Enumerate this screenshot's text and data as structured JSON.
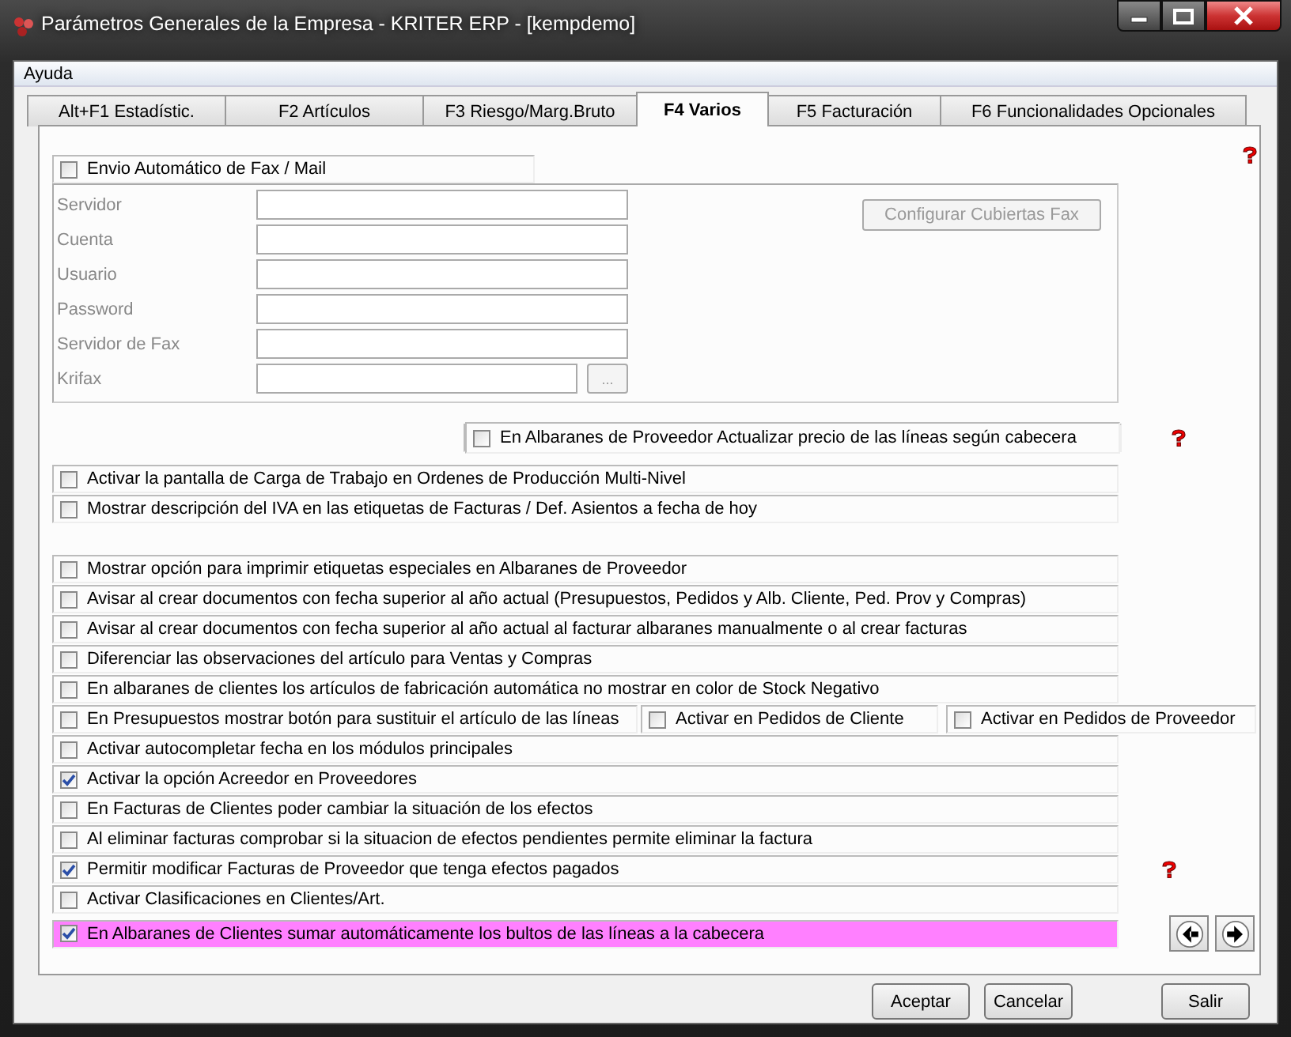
{
  "window": {
    "title": "Parámetros Generales de la Empresa - KRITER ERP - [kempdemo]"
  },
  "menu": [
    "Ayuda"
  ],
  "tabs": [
    {
      "label": "Alt+F1 Estadístic.",
      "selected": false
    },
    {
      "label": "F2 Artículos",
      "selected": false
    },
    {
      "label": "F3 Riesgo/Marg.Bruto",
      "selected": false
    },
    {
      "label": "F4 Varios",
      "selected": true
    },
    {
      "label": "F5 Facturación",
      "selected": false
    },
    {
      "label": "F6 Funcionalidades Opcionales",
      "selected": false
    }
  ],
  "fax": {
    "label": "Envio Automático de Fax / Mail",
    "checked": false,
    "disabled": true,
    "fields": [
      {
        "label": "Servidor"
      },
      {
        "label": "Cuenta"
      },
      {
        "label": "Usuario"
      },
      {
        "label": "Password"
      },
      {
        "label": "Servidor de Fax"
      },
      {
        "label": "Krifax",
        "browse": "..."
      }
    ],
    "cover_button": "Configurar Cubiertas Fax"
  },
  "supplier_price_option": {
    "label": "En Albaranes de Proveedor Actualizar precio de las líneas según cabecera",
    "checked": false
  },
  "options_top": [
    {
      "label": "Activar la pantalla de Carga de Trabajo en Ordenes de Producción Multi-Nivel",
      "checked": false,
      "highlighted": false
    },
    {
      "label": "Mostrar descripción del IVA en las etiquetas de Facturas / Def. Asientos a fecha de hoy",
      "checked": false,
      "highlighted": false
    }
  ],
  "options": [
    {
      "label": "Mostrar opción para imprimir etiquetas especiales en Albaranes de Proveedor",
      "checked": false,
      "highlighted": false
    },
    {
      "label": "Avisar al crear documentos con fecha superior al año actual (Presupuestos, Pedidos y  Alb. Cliente, Ped. Prov y Compras)",
      "checked": false,
      "highlighted": false
    },
    {
      "label": "Avisar al crear documentos con fecha superior al año actual al facturar albaranes manualmente o al crear facturas",
      "checked": false,
      "highlighted": false
    },
    {
      "label": "Diferenciar las observaciones del artículo para Ventas y Compras",
      "checked": false,
      "highlighted": false
    },
    {
      "label": "En albaranes de clientes los artículos de fabricación automática no mostrar en color de Stock Negativo",
      "checked": false,
      "highlighted": false
    },
    {
      "label": "En Presupuestos mostrar botón para sustituir el artículo de las líneas",
      "checked": false,
      "highlighted": false,
      "extras": [
        {
          "label": "Activar en Pedidos de Cliente",
          "checked": false
        },
        {
          "label": "Activar en Pedidos de Proveedor",
          "checked": false
        }
      ]
    },
    {
      "label": "Activar autocompletar fecha en los módulos principales",
      "checked": false,
      "highlighted": false
    },
    {
      "label": "Activar la opción Acreedor en Proveedores",
      "checked": true,
      "highlighted": false
    },
    {
      "label": "En Facturas de Clientes poder cambiar la situación de los efectos",
      "checked": false,
      "highlighted": false
    },
    {
      "label": "Al eliminar facturas comprobar si la situacion de efectos pendientes permite eliminar la factura",
      "checked": false,
      "highlighted": false
    },
    {
      "label": "Permitir modificar Facturas de Proveedor que tenga efectos pagados",
      "checked": true,
      "highlighted": false
    },
    {
      "label": "Activar Clasificaciones en Clientes/Art.",
      "checked": false,
      "highlighted": false
    },
    {
      "label": "En Albaranes de Clientes sumar automáticamente los bultos de las líneas a la cabecera",
      "checked": true,
      "highlighted": true
    }
  ],
  "buttons": [
    {
      "label": "Aceptar"
    },
    {
      "label": "Cancelar"
    },
    {
      "label": "Salir"
    }
  ]
}
